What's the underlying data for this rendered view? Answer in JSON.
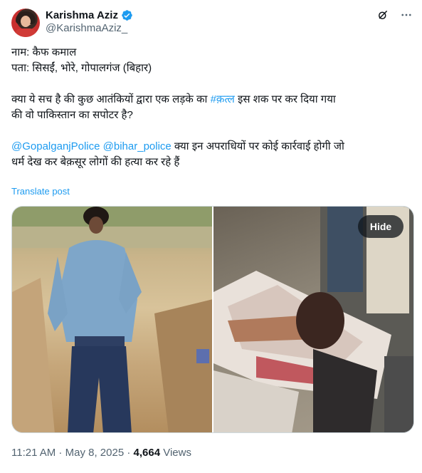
{
  "author": {
    "display_name": "Karishma Aziz",
    "handle": "@KarishmaAziz_",
    "verified_color": "#1d9bf0"
  },
  "header_icons": [
    "grok-icon",
    "more-icon"
  ],
  "post": {
    "line1": "नाम: कैफ कमाल",
    "line2": "पता: सिसईं, भोरे, गोपालगंज (बिहार)",
    "line3_pre": "क्या ये सच है की कुछ आतंकियों द्वारा एक लड़के का ",
    "line3_hashtag": "#क़त्ल",
    "line3_post": " इस शक पर कर दिया गया",
    "line4": "की वो पाकिस्तान का सपोटर है?",
    "mention1": "@GopalganjPolice",
    "mention2": "@bihar_police",
    "line5_post": " क्या इन अपराधियों पर कोई कार्रवाई होगी जो",
    "line6": "धर्म देख कर बेक़सूर लोगों की हत्या कर रहे हैं",
    "translate_label": "Translate post"
  },
  "media": {
    "hide_label": "Hide"
  },
  "meta": {
    "time": "11:21 AM",
    "sep1": " · ",
    "date": "May 8, 2025",
    "sep2": " · ",
    "views_count": "4,664",
    "views_label": " Views"
  },
  "colors": {
    "link": "#1d9bf0",
    "text": "#0f1419",
    "secondary": "#536471",
    "border": "#cfd9de"
  }
}
